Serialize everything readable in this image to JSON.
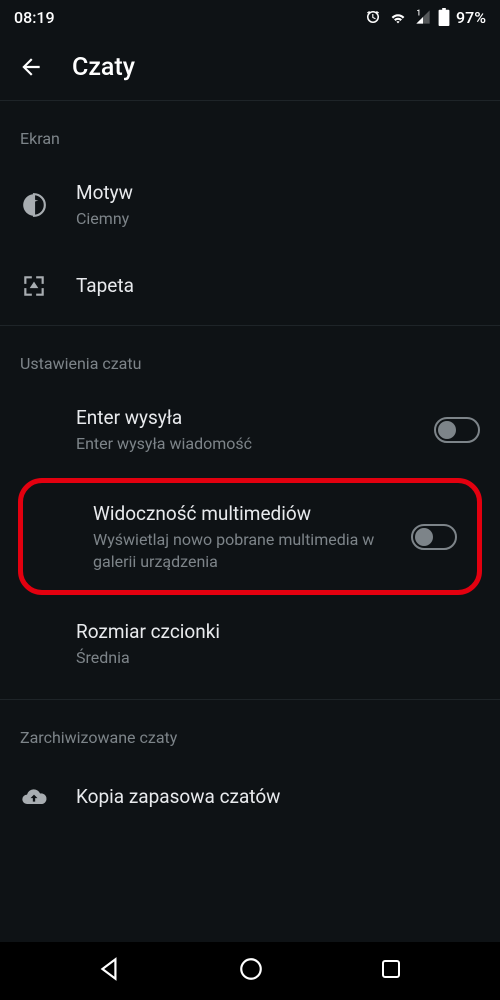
{
  "status": {
    "time": "08:19",
    "battery": "97%"
  },
  "header": {
    "title": "Czaty"
  },
  "sections": {
    "screen": {
      "header": "Ekran",
      "theme": {
        "title": "Motyw",
        "subtitle": "Ciemny"
      },
      "wallpaper": {
        "title": "Tapeta"
      }
    },
    "chat": {
      "header": "Ustawienia czatu",
      "enter": {
        "title": "Enter wysyła",
        "subtitle": "Enter wysyła wiadomość"
      },
      "media": {
        "title": "Widoczność multimediów",
        "subtitle": "Wyświetlaj nowo pobrane multimedia w galerii urządzenia"
      },
      "font": {
        "title": "Rozmiar czcionki",
        "subtitle": "Średnia"
      }
    },
    "archived": {
      "header": "Zarchiwizowane czaty",
      "backup": {
        "title": "Kopia zapasowa czatów"
      }
    }
  }
}
